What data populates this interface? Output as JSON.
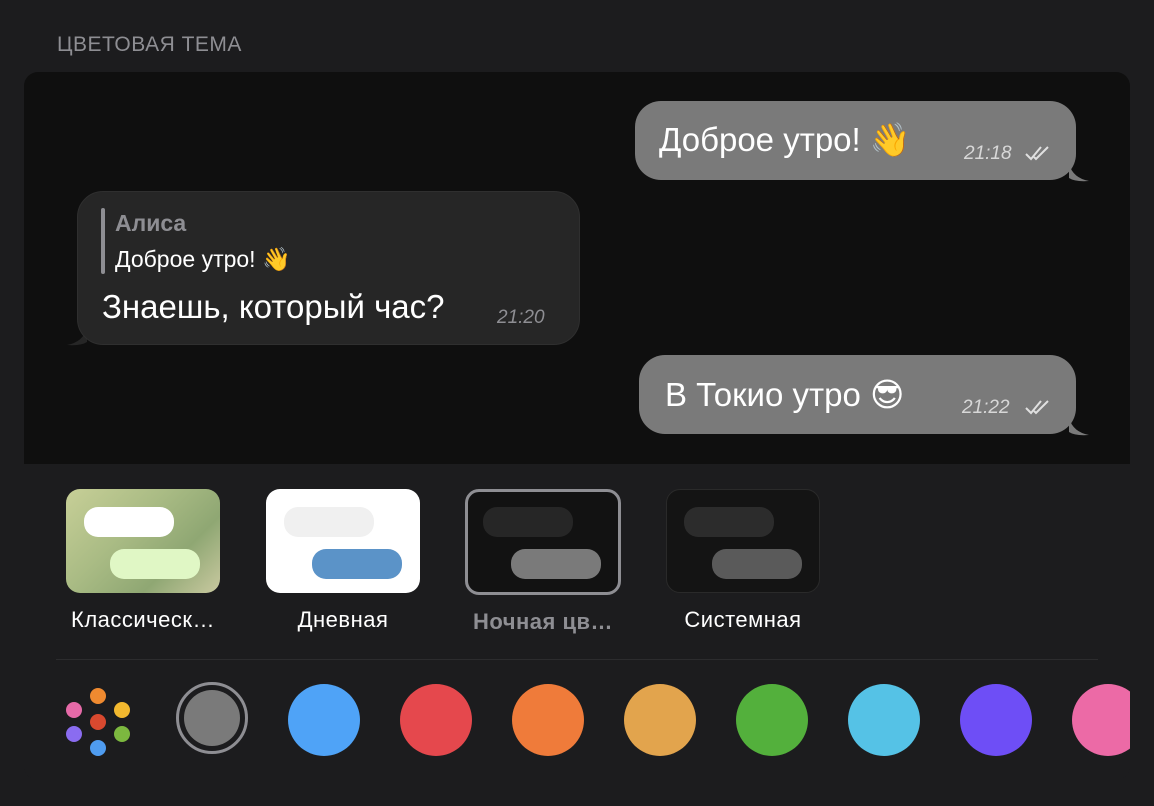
{
  "section_title": "ЦВЕТОВАЯ ТЕМА",
  "preview": {
    "messages": [
      {
        "id": "m1",
        "direction": "out",
        "text": "Доброе утро! 👋",
        "time": "21:18",
        "read": true
      },
      {
        "id": "m2",
        "direction": "in",
        "reply_author": "Алиса",
        "reply_text": "Доброе утро! 👋",
        "text": "Знаешь, который час?",
        "time": "21:20"
      },
      {
        "id": "m3",
        "direction": "out",
        "text": "В Токио утро 😎",
        "time": "21:22",
        "read": true
      }
    ]
  },
  "themes": [
    {
      "label": "Классическ…",
      "selected": false
    },
    {
      "label": "Дневная",
      "selected": false
    },
    {
      "label": "Ночная цв…",
      "selected": true
    },
    {
      "label": "Системная",
      "selected": false
    }
  ],
  "accent_colors": [
    {
      "name": "custom-palette-icon"
    },
    {
      "name": "gray",
      "hex": "#7a7a7a",
      "selected": true
    },
    {
      "name": "blue",
      "hex": "#4fa3f7"
    },
    {
      "name": "red",
      "hex": "#e5484d"
    },
    {
      "name": "orange",
      "hex": "#ef7b3a"
    },
    {
      "name": "yellow",
      "hex": "#e2a44d"
    },
    {
      "name": "green",
      "hex": "#53b03c"
    },
    {
      "name": "cyan",
      "hex": "#55c2e6"
    },
    {
      "name": "purple",
      "hex": "#6e4ef6"
    },
    {
      "name": "pink",
      "hex": "#ec6aa6"
    }
  ]
}
